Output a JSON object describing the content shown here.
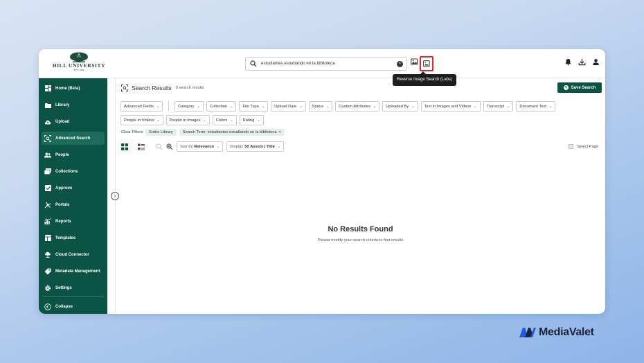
{
  "app": {
    "logo": {
      "name": "HILL UNIVERSITY",
      "established": "EST. 1984"
    },
    "search": {
      "value": "estudiantes estudiando en la biblioteca"
    },
    "tooltip": "Reverse Image Search (Labs)",
    "sidebar": {
      "items": [
        {
          "label": "Home (Beta)",
          "icon": "home-grid-icon"
        },
        {
          "label": "Library",
          "icon": "folder-icon"
        },
        {
          "label": "Upload",
          "icon": "cloud-upload-icon"
        },
        {
          "label": "Advanced Search",
          "icon": "advanced-search-icon",
          "active": true
        },
        {
          "label": "People",
          "icon": "people-icon"
        },
        {
          "label": "Collections",
          "icon": "collections-icon"
        },
        {
          "label": "Approve",
          "icon": "approve-check-icon"
        },
        {
          "label": "Portals",
          "icon": "portals-icon"
        },
        {
          "label": "Reports",
          "icon": "reports-chart-icon"
        },
        {
          "label": "Templates",
          "icon": "templates-icon"
        },
        {
          "label": "Cloud Connector",
          "icon": "cloud-connector-icon"
        },
        {
          "label": "Metadata Management",
          "icon": "metadata-tag-icon"
        },
        {
          "label": "Settings",
          "icon": "gear-icon"
        }
      ],
      "collapse_label": "Collapse"
    },
    "page": {
      "title": "Search Results",
      "count": "0 search results",
      "save_search": "Save Search"
    },
    "filters": {
      "row1": [
        "Advanced Fields",
        "Category",
        "Collection",
        "File Type",
        "Upload Date",
        "Status",
        "Custom Attributes",
        "Uploaded By",
        "Text in Images and Videos",
        "Transcript",
        "Document Text"
      ],
      "row2": [
        "People in Videos",
        "People in Images",
        "Colors",
        "Rating"
      ]
    },
    "active_filters": {
      "clear_label": "Clear Filters",
      "library_tag": "Entire Library",
      "search_tag": "Search Term: estudiantes estudiando en la biblioteca"
    },
    "toolbar": {
      "sort_prefix": "Sort by",
      "sort_value": "Relevance",
      "display_prefix": "Display",
      "display_value": "50 Assets | Title",
      "select_page": "Select Page"
    },
    "empty_state": {
      "title": "No Results Found",
      "subtitle": "Please modify your search criteria to find results"
    }
  },
  "brand": {
    "name": "MediaValet"
  },
  "colors": {
    "sidebar": "#0b5445",
    "accent": "#0b5445",
    "highlight": "#e0282e"
  }
}
